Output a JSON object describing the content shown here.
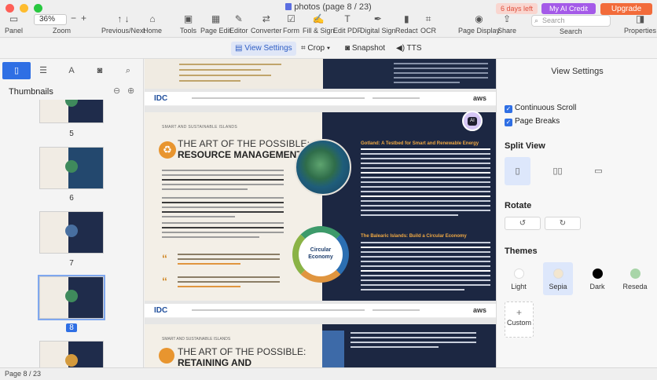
{
  "window": {
    "title": "photos (page 8 / 23)"
  },
  "badges": {
    "trial": "6 days left",
    "ai_credit": "My AI Credit",
    "upgrade": "Upgrade"
  },
  "toolbar": {
    "panel": "Panel",
    "zoom_value": "36%",
    "zoom_label": "Zoom",
    "prev_next": "Previous/Next",
    "home": "Home",
    "tools": "Tools",
    "page_edit": "Page Edit",
    "editor": "Editor",
    "converter": "Converter",
    "form": "Form",
    "fill_sign": "Fill & Sign",
    "edit_pdf": "Edit PDF",
    "digital_sign": "Digital Sign",
    "redact": "Redact",
    "ocr": "OCR",
    "page_display": "Page Display",
    "share": "Share",
    "search_placeholder": "Search",
    "search_label": "Search",
    "properties": "Properties"
  },
  "subtoolbar": {
    "view_settings": "View Settings",
    "crop": "Crop",
    "snapshot": "Snapshot",
    "tts": "TTS"
  },
  "leftpanel": {
    "title": "Thumbnails",
    "thumbnails": [
      {
        "page": "5"
      },
      {
        "page": "6"
      },
      {
        "page": "7"
      },
      {
        "page": "8",
        "selected": true
      }
    ]
  },
  "document": {
    "header_logo": "IDC",
    "header_aws": "aws",
    "section_tag": "SMART AND SUSTAINABLE ISLANDS",
    "title_line1": "THE ART OF THE POSSIBLE:",
    "title_line2": "RESOURCE MANAGEMENT",
    "right_heading1": "Gotland: A Testbed for Smart and Renewable Energy",
    "right_heading2": "The Balearic Islands: Build a Circular Economy",
    "circular_label": "Circular Economy",
    "next_title1": "THE ART OF THE POSSIBLE:",
    "next_title2": "RETAINING AND",
    "ai_badge": "AI"
  },
  "rightpanel": {
    "title": "View Settings",
    "continuous_scroll": "Continuous Scroll",
    "page_breaks": "Page Breaks",
    "split_view": "Split View",
    "rotate": "Rotate",
    "themes": "Themes",
    "theme_list": [
      {
        "name": "Light",
        "color": "#ffffff"
      },
      {
        "name": "Sepia",
        "color": "#f3e6cf",
        "selected": true
      },
      {
        "name": "Dark",
        "color": "#000000"
      },
      {
        "name": "Reseda",
        "color": "#a8d5a8"
      }
    ],
    "custom": "Custom"
  },
  "status": {
    "page": "Page 8 / 23"
  },
  "colors": {
    "accent": "#2f6fe4",
    "upgrade": "#f26b3a",
    "ai": "#a45ae8",
    "doc_dark": "#1c2742",
    "doc_light": "#f3efe7"
  }
}
